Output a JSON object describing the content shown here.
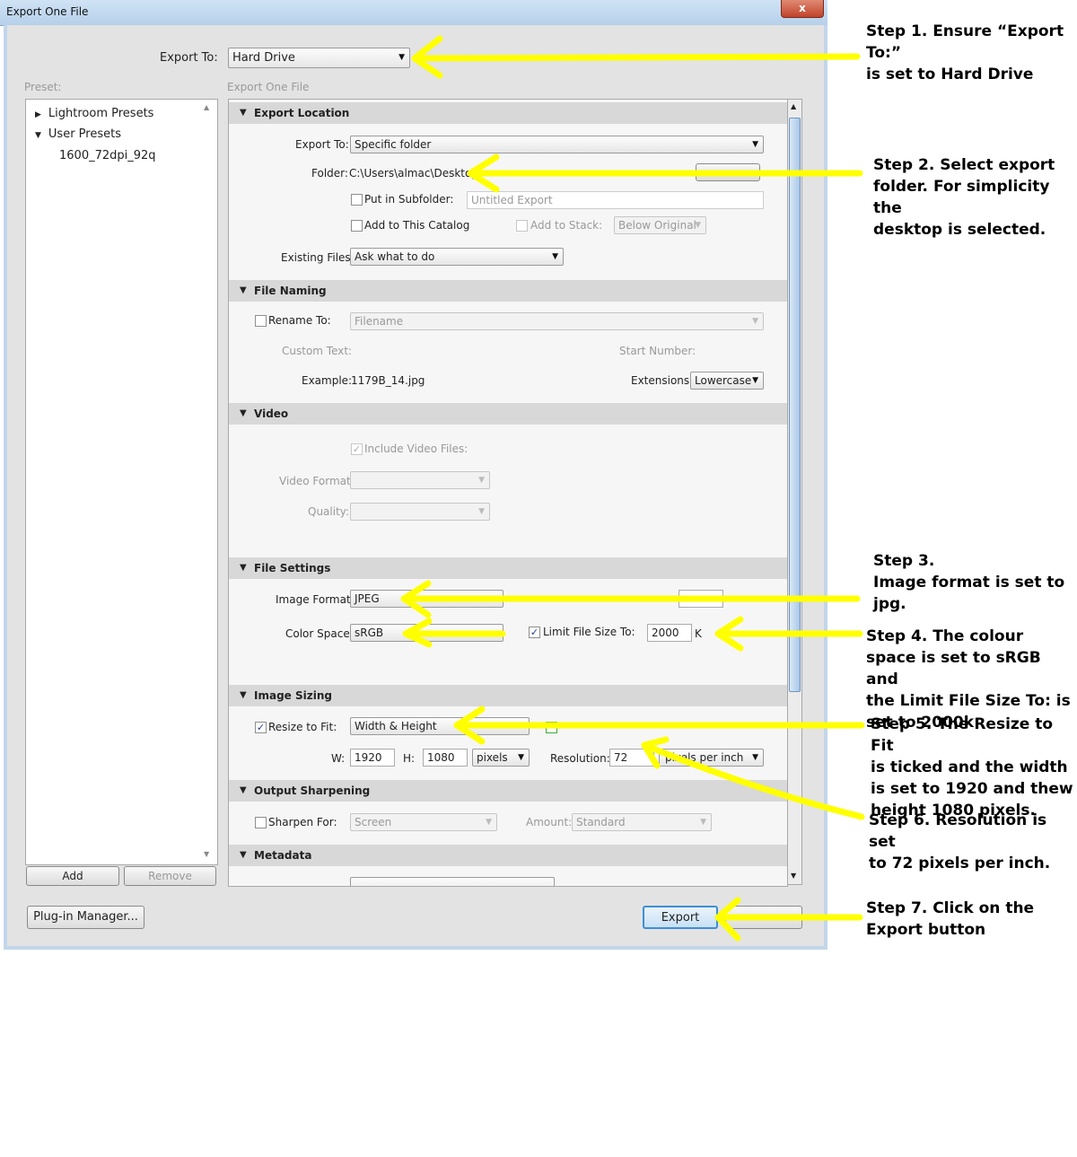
{
  "window": {
    "title": "Export One File",
    "close": "x"
  },
  "export_to": {
    "label": "Export To:",
    "value": "Hard Drive"
  },
  "preset": {
    "label": "Preset:",
    "items": [
      {
        "label": "Lightroom Presets",
        "expanded": false
      },
      {
        "label": "User Presets",
        "expanded": true
      },
      {
        "label": "1600_72dpi_92q",
        "child": true
      }
    ],
    "add": "Add",
    "remove": "Remove"
  },
  "panel_title": "Export One File",
  "export_location": {
    "header": "Export Location",
    "export_to_label": "Export To:",
    "export_to_value": "Specific folder",
    "folder_label": "Folder:",
    "folder_value": "C:\\Users\\almac\\Desktop",
    "subfolder_label": "Put in Subfolder:",
    "subfolder_value": "Untitled Export",
    "add_catalog_label": "Add to This Catalog",
    "add_stack_label": "Add to Stack:",
    "add_stack_value": "Below Original",
    "existing_label": "Existing Files:",
    "existing_value": "Ask what to do"
  },
  "file_naming": {
    "header": "File Naming",
    "rename_label": "Rename To:",
    "rename_value": "Filename",
    "custom_text_label": "Custom Text:",
    "start_number_label": "Start Number:",
    "example_label": "Example:",
    "example_value": "1179B_14.jpg",
    "extensions_label": "Extensions:",
    "extensions_value": "Lowercase"
  },
  "video": {
    "header": "Video",
    "include_label": "Include Video Files:",
    "format_label": "Video Format:",
    "quality_label": "Quality:"
  },
  "file_settings": {
    "header": "File Settings",
    "format_label": "Image Format:",
    "format_value": "JPEG",
    "color_label": "Color Space:",
    "color_value": "sRGB",
    "limit_label": "Limit File Size To:",
    "limit_value": "2000",
    "limit_unit": "K"
  },
  "image_sizing": {
    "header": "Image Sizing",
    "resize_label": "Resize to Fit:",
    "resize_value": "Width & Height",
    "w_label": "W:",
    "w_value": "1920",
    "h_label": "H:",
    "h_value": "1080",
    "unit_value": "pixels",
    "resolution_label": "Resolution:",
    "resolution_value": "72",
    "res_unit_value": "pixels per inch"
  },
  "output_sharpening": {
    "header": "Output Sharpening",
    "sharpen_label": "Sharpen For:",
    "sharpen_value": "Screen",
    "amount_label": "Amount:",
    "amount_value": "Standard"
  },
  "metadata": {
    "header": "Metadata"
  },
  "buttons": {
    "plugin": "Plug-in Manager...",
    "export": "Export"
  },
  "steps": [
    {
      "lines": [
        "Step 1. Ensure “Export To:”",
        "is set to Hard Drive"
      ]
    },
    {
      "lines": [
        "Step 2. Select export",
        "folder. For simplicity the",
        "desktop is selected."
      ]
    },
    {
      "lines": [
        "Step 3.",
        "Image format is set to",
        "jpg."
      ]
    },
    {
      "lines": [
        "Step 4.  The colour",
        "space is set to sRGB and",
        "the Limit File Size To: is",
        "set to 2000k"
      ]
    },
    {
      "lines": [
        "Step 5.  The Resize to Fit",
        "is ticked and the width",
        "is set to 1920 and thew",
        "height 1080 pixels."
      ]
    },
    {
      "lines": [
        "Step 6.  Resolution is set",
        "to 72 pixels per inch."
      ]
    },
    {
      "lines": [
        "Step 7.  Click on the",
        "Export button"
      ]
    }
  ],
  "colors": {
    "arrow": "#ffff00",
    "section_header": "#d8d8d8",
    "dialog": "#e3e3e3"
  }
}
